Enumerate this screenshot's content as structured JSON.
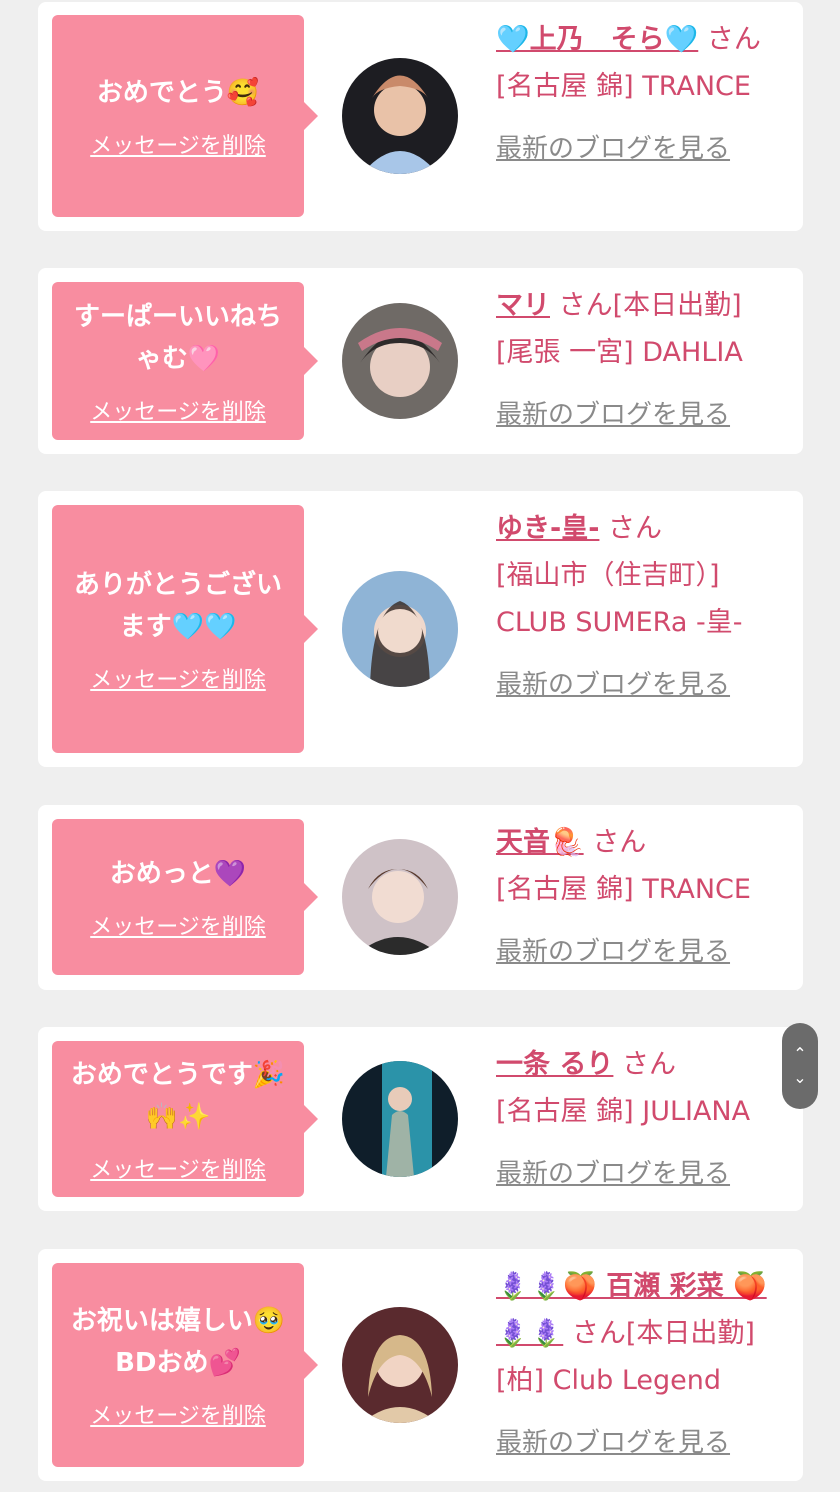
{
  "delete_label": "メッセージを削除",
  "blog_label": "最新のブログを見る",
  "colors": {
    "bubble": "#f88da0",
    "name": "#d14a6d",
    "blog": "#8a8a8a",
    "card": "#ffffff",
    "bg": "#efefef"
  },
  "cards": [
    {
      "message": "おめでとう🥰",
      "name": "🩵上乃　そら🩵",
      "suffix": "さん",
      "shop": "[名古屋 錦] TRANCE",
      "avatar_icon": "photo-avatar"
    },
    {
      "message": "すーぱーいいねちゃむ🩷",
      "name": "マリ",
      "suffix": "さん[本日出勤]",
      "shop": "[尾張 一宮] DAHLIA",
      "avatar_icon": "photo-avatar"
    },
    {
      "message": "ありがとうございます🩵🩵",
      "name": "ゆき-皇-",
      "suffix": "さん",
      "shop": "[福山市（住吉町）] CLUB SUMERa -皇-",
      "avatar_icon": "photo-avatar"
    },
    {
      "message": "おめっと💜",
      "name": "天音🪼",
      "suffix": "さん",
      "shop": "[名古屋 錦] TRANCE",
      "avatar_icon": "photo-avatar"
    },
    {
      "message": "おめでとうです🎉🙌✨",
      "name": "一条 るり",
      "suffix": "さん",
      "shop": "[名古屋 錦] JULIANA",
      "avatar_icon": "photo-avatar"
    },
    {
      "message": "お祝いは嬉しい🥹BDおめ💕",
      "name": "🪻🪻🍑 百瀬 彩菜 🍑🪻🪻",
      "suffix": "さん[本日出勤]",
      "shop": "[柏] Club Legend",
      "avatar_icon": "photo-avatar"
    }
  ],
  "scroll_up_icon": "chevron-up-icon",
  "scroll_down_icon": "chevron-down-icon"
}
